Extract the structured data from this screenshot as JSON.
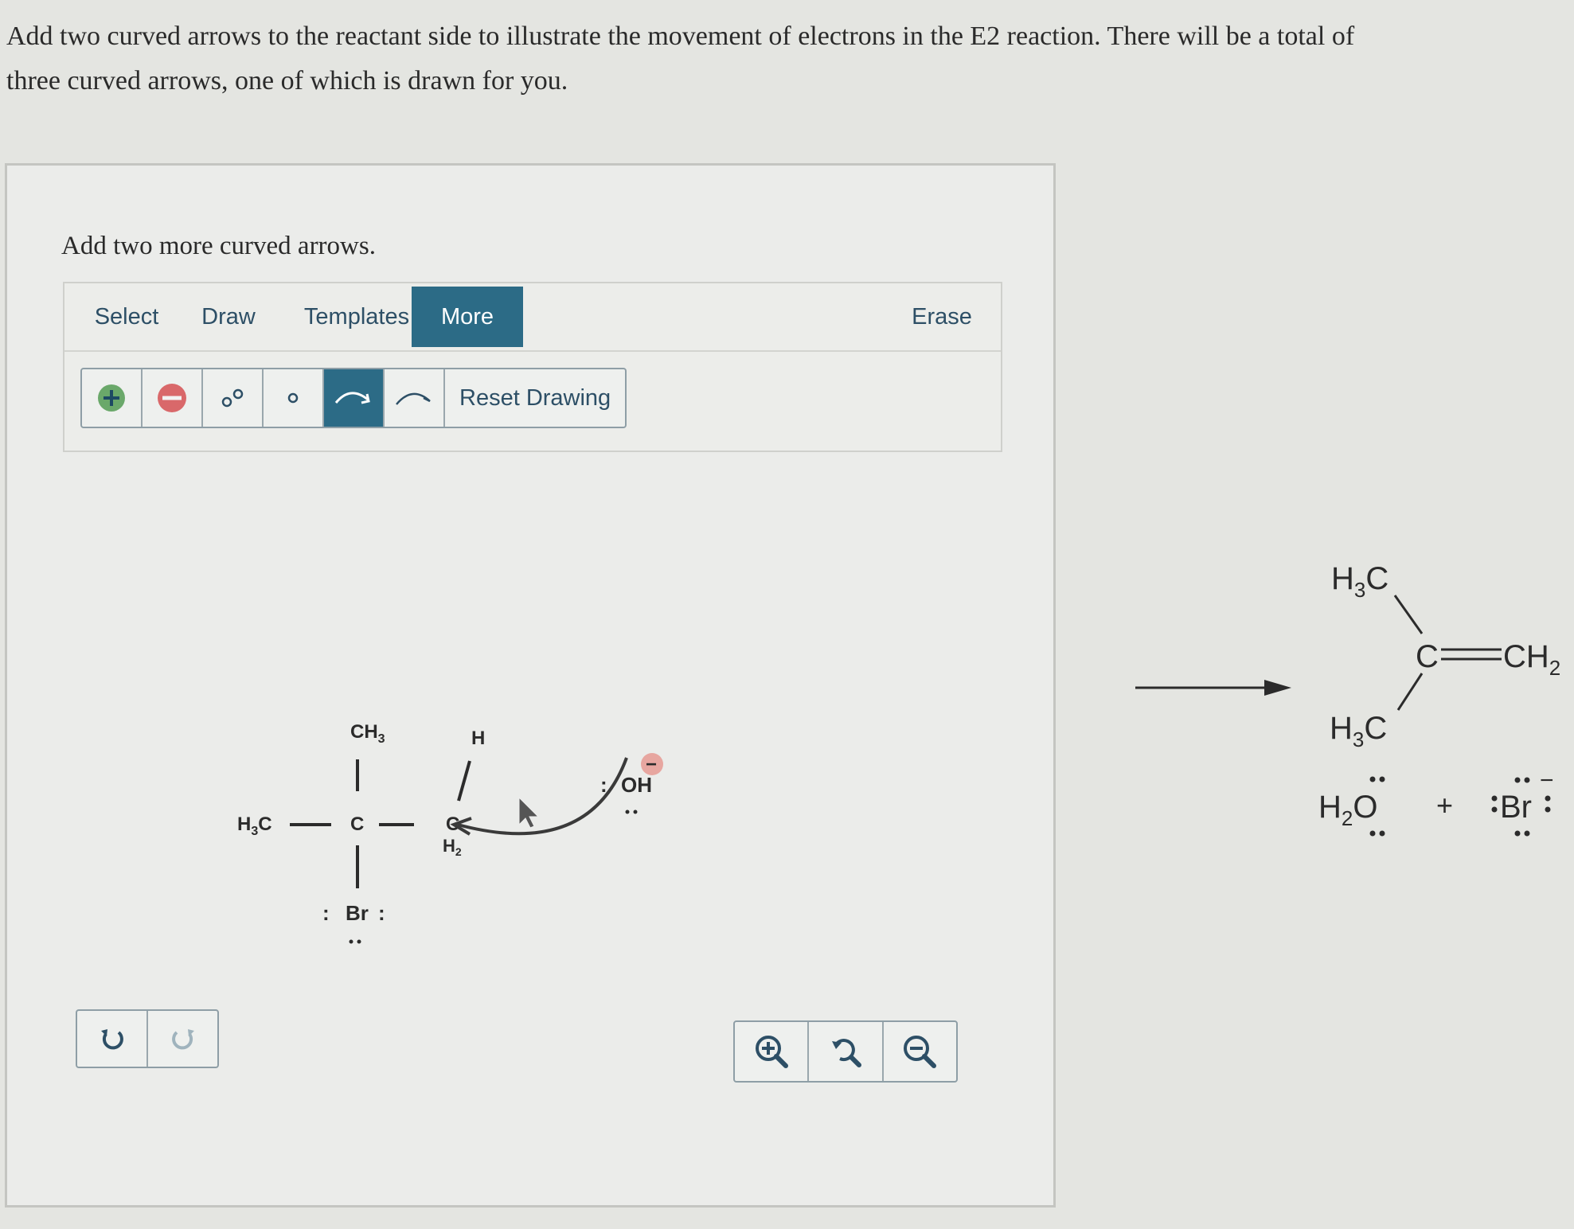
{
  "question": {
    "line1": "Add two curved arrows to the reactant side to illustrate the movement of electrons in the E2 reaction. There will be a total of",
    "line2": "three curved arrows, one of which is drawn for you."
  },
  "panel": {
    "instruction": "Add two more curved arrows."
  },
  "tabs": {
    "select": "Select",
    "draw": "Draw",
    "templates": "Templates",
    "more": "More",
    "erase": "Erase"
  },
  "tools": {
    "add_charge_icon": "plus-circle-icon",
    "remove_charge_icon": "minus-circle-icon",
    "lone_pair_icon": "two-dots-icon",
    "radical_icon": "single-dot-icon",
    "curved_arrow_icon": "curved-arrow-icon",
    "half_arrow_icon": "fishhook-arrow-icon",
    "reset_label": "Reset Drawing"
  },
  "reactant": {
    "ch3_top": "CH",
    "ch3_top_sub": "3",
    "h3c_left": "H",
    "h3c_left_sub": "3",
    "h3c_left_c": "C",
    "center_c": "C",
    "h2": "H",
    "h2_sub": "2",
    "h_top": "H",
    "br": "Br",
    "hydroxide": "OH",
    "hydroxide_charge": "−"
  },
  "product": {
    "h3c_top": "H",
    "h3c_top_sub": "3",
    "h3c_top_c": "C",
    "alkene_c": "C",
    "ch2": "CH",
    "ch2_sub": "2",
    "h3c_bottom": "H",
    "h3c_bottom_sub": "3",
    "h3c_bottom_c": "C",
    "water_h": "H",
    "water_sub": "2",
    "water_o": "O",
    "plus": "+",
    "bromide": "Br",
    "bromide_charge": "−"
  },
  "colors": {
    "accent": "#2c6b86",
    "plus_green": "#6aa86a",
    "minus_red": "#d9686a",
    "charge_badge": "#e7a6a0"
  }
}
